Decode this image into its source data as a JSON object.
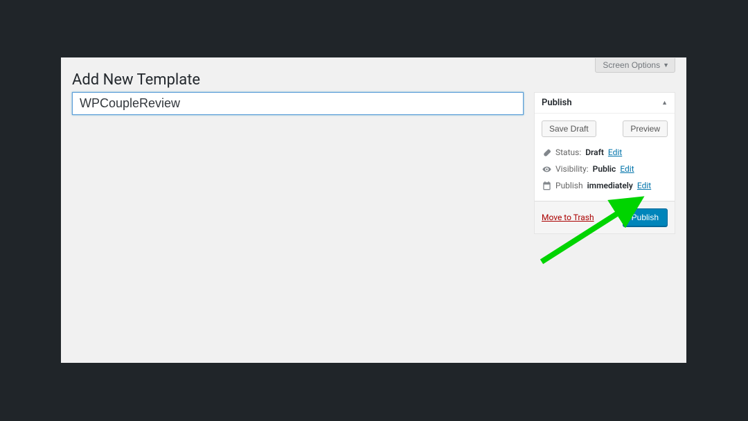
{
  "screen_options_label": "Screen Options",
  "page_title": "Add New Template",
  "title_value": "WPCoupleReview",
  "publish": {
    "header": "Publish",
    "save_draft": "Save Draft",
    "preview": "Preview",
    "status_label": "Status:",
    "status_value": "Draft",
    "visibility_label": "Visibility:",
    "visibility_value": "Public",
    "schedule_label": "Publish",
    "schedule_value": "immediately",
    "edit": "Edit",
    "trash": "Move to Trash",
    "publish_btn": "Publish"
  }
}
